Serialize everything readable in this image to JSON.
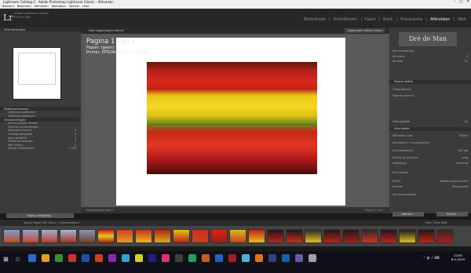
{
  "window": {
    "title": "Lightroom Catalog-2 - Adobe Photoshop Lightroom Classic - Afdrukken"
  },
  "menu": [
    "Bestand",
    "Bewerken",
    "Afdrukken",
    "Weergave",
    "Venster",
    "Help"
  ],
  "identity": {
    "logo": "Lr",
    "line1": "Adobe Lightroom Classic",
    "line2": "Dré De Man"
  },
  "modules": [
    "Bibliotheek",
    "Ontwikkelen",
    "Kaart",
    "Boek",
    "Presentatie",
    "Afdrukken",
    "Web"
  ],
  "active_module": "Afdrukken",
  "left": {
    "preview_header": "Voorvertoning",
    "template_header": "Sjabloonbrowser",
    "template_items": [
      "Lightroom-sjablonen",
      "Gebruikerssjablonen"
    ],
    "collections_header": "Verzamelingen",
    "collections_sub": "Verzamelingen filteren",
    "tree": [
      {
        "label": "Slimme verzamelingen",
        "count": ""
      },
      {
        "label": "Afgelopen maand",
        "count": "0"
      },
      {
        "label": "Onlangs gewijzigd",
        "count": "0"
      },
      {
        "label": "Rood gelabeld",
        "count": "0"
      },
      {
        "label": "Vijfsterrenwaarden",
        "count": "1"
      },
      {
        "label": "Met video's",
        "count": "0"
      },
      {
        "label": "Zonder trefwoorden",
        "count": "1 958"
      }
    ],
    "button": "Pagina instelling..."
  },
  "center": {
    "header": "Niet-opgeslagen afdruk",
    "header_button": "Opgeslagen afdruk maken",
    "page_title": "Pagina 1 van 1",
    "page_sub1": "Papier: (geen)",
    "page_sub2": "Printer: EPSON Stylus Pro 4900",
    "footer": "Geselecteerde foto's",
    "footer_right": "Pagina 1 van 1"
  },
  "right": {
    "photo_text": "Dré de Man",
    "rows": [
      {
        "label": "Rand vervangen",
        "value": ""
      },
      {
        "label": "Afmeting",
        "value": "0"
      },
      {
        "label": "Breedte",
        "value": "0.0"
      },
      {
        "label": "Pagina-opties",
        "value": ""
      },
      {
        "label": "Fotogegevens",
        "value": ""
      },
      {
        "label": "Paginanummers",
        "value": ""
      },
      {
        "label": "Tekengrootte",
        "value": "10"
      }
    ],
    "section_print": "Afdruktaak",
    "print_rows": [
      {
        "label": "Afdrukken naar",
        "value": "Printer"
      },
      {
        "label": "Afdrukken in conceptmodus",
        "value": ""
      },
      {
        "label": "Afdrukresolutie",
        "value": "240 ppi"
      },
      {
        "label": "Afdruk verscherpen",
        "value": "Laag"
      },
      {
        "label": "Mediatype",
        "value": "Glanzend"
      },
      {
        "label": "Kleurbeheer",
        "value": ""
      },
      {
        "label": "Profiel",
        "value": "Beheerd door printer"
      },
      {
        "label": "Intentie",
        "value": "Perceptueel"
      },
      {
        "label": "Afdrukaanpassing",
        "value": ""
      }
    ],
    "btn_printer": "Afdr.ken...",
    "btn_print": "Printer..."
  },
  "filmstrip": {
    "nav": "Vorige import",
    "count": "567 foto's / 1 geselecteerd /",
    "filter": "Filter:",
    "filter_val": "Geen filter"
  },
  "taskbar": {
    "time": "12:00",
    "date": "8-5-2019"
  }
}
